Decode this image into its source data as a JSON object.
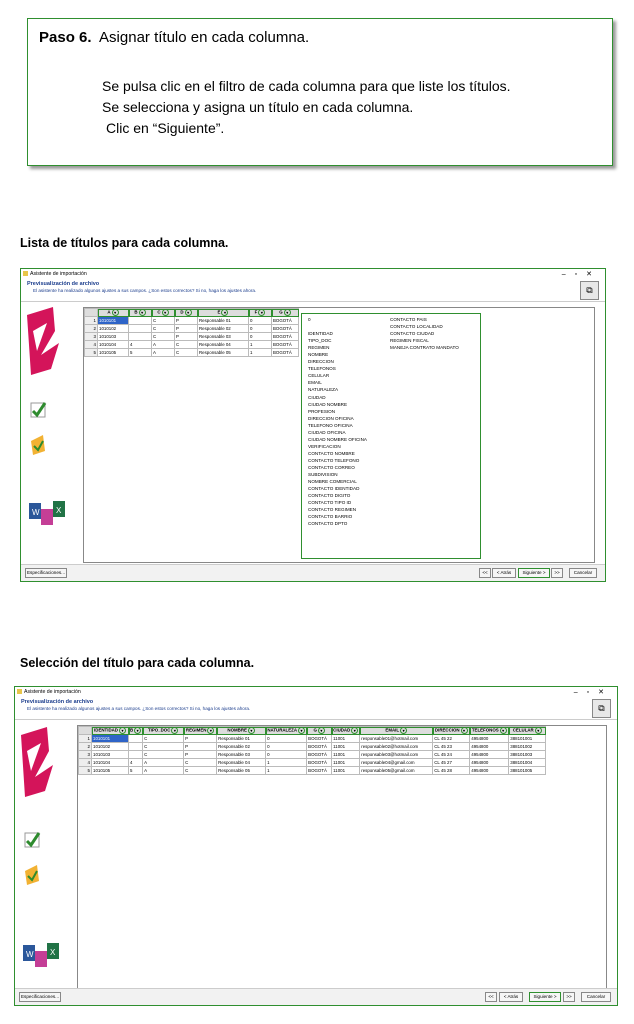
{
  "step": {
    "number": "Paso 6.",
    "title": "Asignar título en cada columna.",
    "lines": [
      "Se pulsa clic en el filtro de cada columna para que liste los títulos.",
      "Se selecciona y asigna un título en cada columna.",
      "Clic en “Siguiente”."
    ]
  },
  "captions": {
    "first": "Lista de títulos para cada columna.",
    "second": "Selección del título para cada columna."
  },
  "window": {
    "title": "Asistente de importación",
    "header_title": "Previsualización de archivo",
    "header_sub": "El asistente ha realizado algunos ajustes a sus campos. ¿Son estos correctos? Si no, haga los ajustes ahora.",
    "buttons": {
      "spec": "Especificaciones...",
      "first": "<<",
      "back": "< Atrás",
      "next": "Siguiente >",
      "last": ">>",
      "cancel": "Cancelar"
    }
  },
  "grid1": {
    "headers": [
      "A",
      "B",
      "C",
      "D",
      "E",
      "F",
      "G"
    ],
    "rows": [
      [
        "1010101",
        "",
        "C",
        "P",
        "Responsable 01",
        "0",
        "BOGOTÁ"
      ],
      [
        "1010102",
        "",
        "C",
        "P",
        "Responsable 02",
        "0",
        "BOGOTÁ"
      ],
      [
        "1010103",
        "",
        "C",
        "P",
        "Responsable 03",
        "0",
        "BOGOTÁ"
      ],
      [
        "1010104",
        "4",
        "A",
        "C",
        "Responsable 04",
        "1",
        "BOGOTÁ"
      ],
      [
        "1010105",
        "5",
        "A",
        "C",
        "Responsable 05",
        "1",
        "BOGOTÁ"
      ]
    ]
  },
  "dropdown": {
    "col1": [
      "0",
      "",
      "IDENTIDAD",
      "TIPO_DOC",
      "REGIMEN",
      "NOMBRE",
      "DIRECCION",
      "TELEFONOS",
      "CELULAR",
      "EMAIL",
      "NATURALEZA",
      "CIUDAD",
      "CIUDAD NOMBRE",
      "PROFESION",
      "DIRECCION OFICINA",
      "TELEFONO OFICINA",
      "CIUDAD OFICINA",
      "CIUDAD NOMBRE OFICINA",
      "VERIFICACION",
      "CONTACTO NOMBRE",
      "CONTACTO TELEFONO",
      "CONTACTO CORREO",
      "SUBDIVISION",
      "NOMBRE COMERCIAL",
      "CONTACTO IDENTIDAD",
      "CONTACTO DIGITO",
      "CONTACTO TIPO ID",
      "CONTACTO REGIMEN",
      "CONTACTO BARRIO",
      "CONTACTO DPTO"
    ],
    "col2": [
      "CONTACTO PAIS",
      "CONTACTO LOCALIDAD",
      "CONTACTO CIUDAD",
      "REGIMEN FISCAL",
      "MANEJA CONTRATO MANDATO"
    ]
  },
  "grid2": {
    "headers": [
      "IDENTIDAD",
      "B",
      "TIPO_DOC",
      "REGIMEN",
      "NOMBRE",
      "NATURALEZA",
      "G",
      "CIUDAD",
      "EMAIL",
      "DIRECCION",
      "TELEFONOS",
      "CELULAR"
    ],
    "rows": [
      [
        "1010101",
        "",
        "C",
        "P",
        "Responsable 01",
        "0",
        "BOGOTÁ",
        "11001",
        "responsable01@hotmail.com",
        "CL 45 22",
        "4954800",
        "388101001"
      ],
      [
        "1010102",
        "",
        "C",
        "P",
        "Responsable 02",
        "0",
        "BOGOTÁ",
        "11001",
        "responsable02@hotmail.com",
        "CL 45 23",
        "4954800",
        "388101002"
      ],
      [
        "1010103",
        "",
        "C",
        "P",
        "Responsable 03",
        "0",
        "BOGOTÁ",
        "11001",
        "responsable03@hotmail.com",
        "CL 45 24",
        "4954800",
        "388101003"
      ],
      [
        "1010104",
        "4",
        "A",
        "C",
        "Responsable 04",
        "1",
        "BOGOTÁ",
        "11001",
        "responsable04@gmail.com",
        "CL 45 27",
        "4954800",
        "388101004"
      ],
      [
        "1010105",
        "5",
        "A",
        "C",
        "Responsable 05",
        "1",
        "BOGOTÁ",
        "11001",
        "responsable05@gmail.com",
        "CL 45 28",
        "4954800",
        "388101005"
      ]
    ]
  },
  "colors": {
    "accent": "#2f8f2f",
    "header_blue": "#1a3c8c"
  }
}
